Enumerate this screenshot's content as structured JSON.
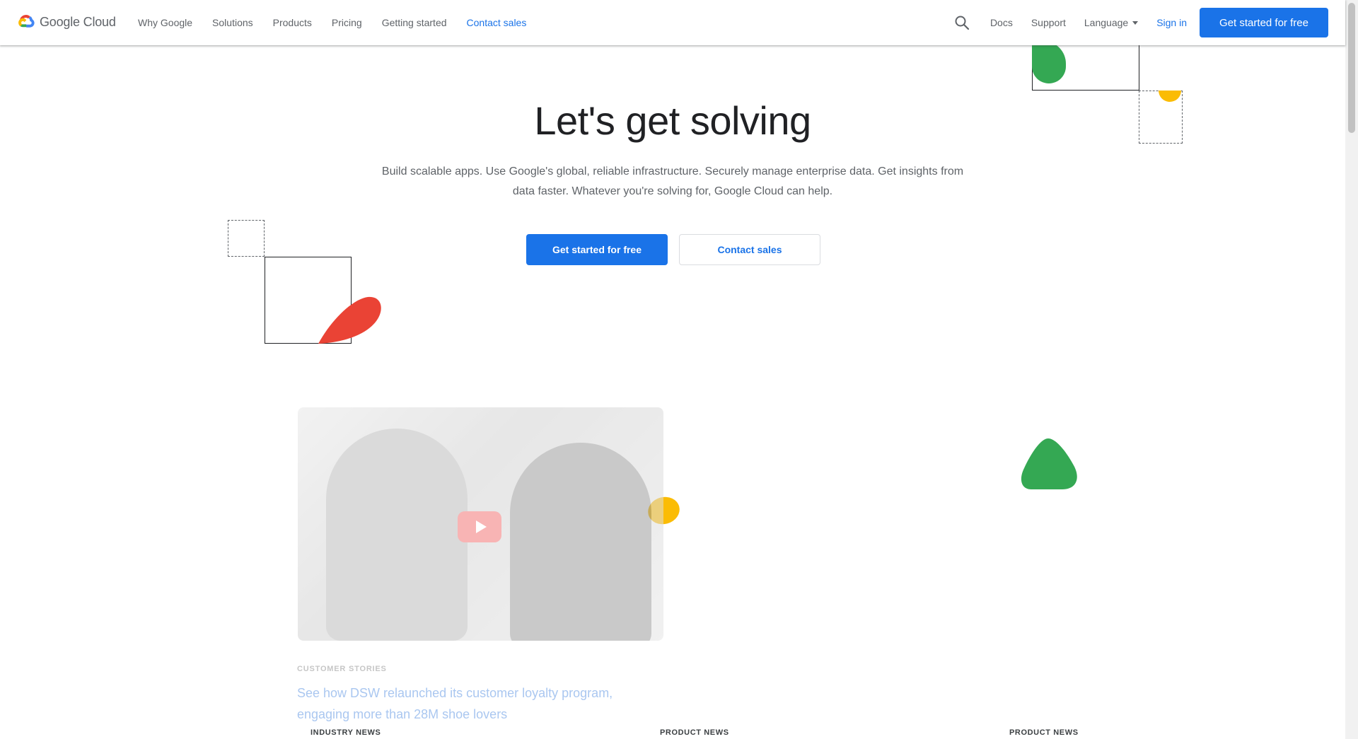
{
  "header": {
    "logo_text": "Google Cloud",
    "nav": [
      "Why Google",
      "Solutions",
      "Products",
      "Pricing",
      "Getting started",
      "Contact sales"
    ],
    "docs": "Docs",
    "support": "Support",
    "language": "Language",
    "sign_in": "Sign in",
    "cta": "Get started for free"
  },
  "hero": {
    "title": "Let's get solving",
    "subtitle": "Build scalable apps. Use Google's global, reliable infrastructure. Securely manage enterprise data. Get insights from data faster. Whatever you're solving for, Google Cloud can help.",
    "primary_btn": "Get started for free",
    "secondary_btn": "Contact sales"
  },
  "story": {
    "eyebrow": "CUSTOMER STORIES",
    "title": "See how DSW relaunched its customer loyalty program, engaging more than 28M shoe lovers"
  },
  "news": [
    "INDUSTRY NEWS",
    "PRODUCT NEWS",
    "PRODUCT NEWS"
  ],
  "colors": {
    "blue": "#1a73e8",
    "red": "#ea4335",
    "green": "#34a853",
    "yellow": "#fbbc04"
  }
}
